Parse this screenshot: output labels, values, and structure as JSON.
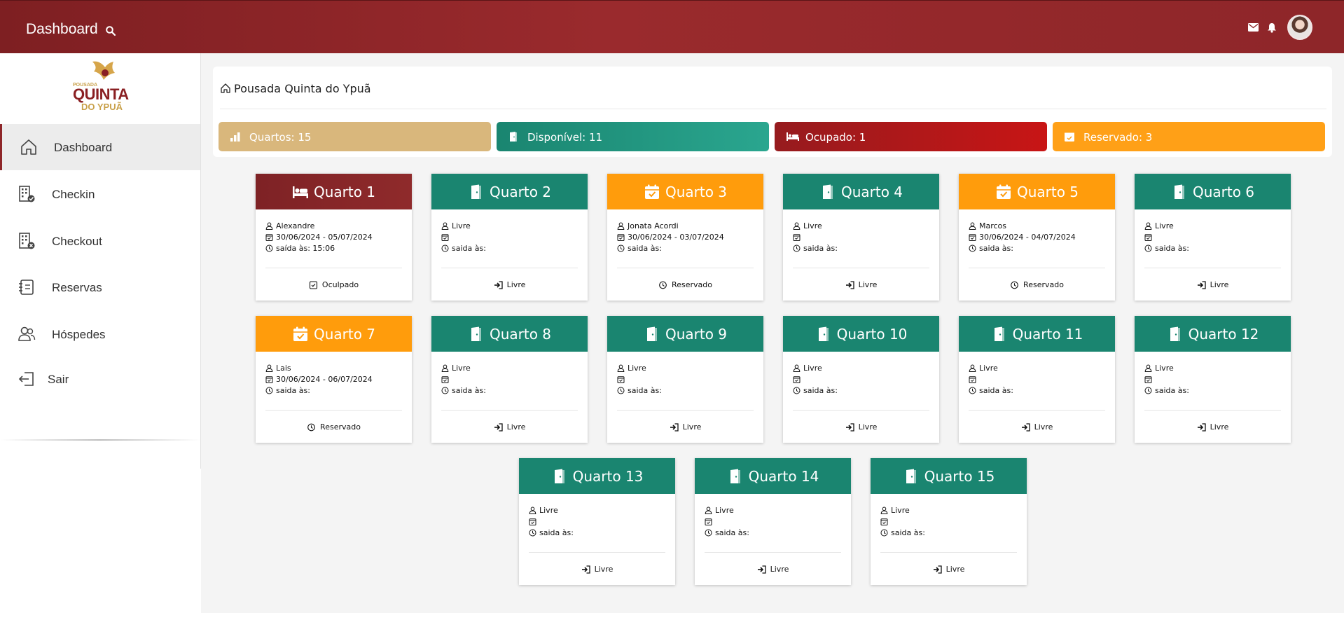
{
  "topbar": {
    "title": "Dashboard",
    "icons": [
      "search-icon",
      "mail-icon",
      "bell-icon"
    ],
    "color": "#8e2629"
  },
  "logo": {
    "small": "POUSADA",
    "big": "QUINTA",
    "sub": "DO YPUÃ"
  },
  "sidebar": {
    "items": [
      {
        "label": "Dashboard",
        "icon": "home-icon",
        "active": true
      },
      {
        "label": "Checkin",
        "icon": "building-check-icon"
      },
      {
        "label": "Checkout",
        "icon": "building-x-icon"
      },
      {
        "label": "Reservas",
        "icon": "reservation-list-icon"
      },
      {
        "label": "Hóspedes",
        "icon": "guests-icon"
      },
      {
        "label": "Sair",
        "icon": "logout-icon"
      }
    ]
  },
  "breadcrumb": {
    "icon": "home-icon",
    "text": "Pousada Quinta do Ypuã"
  },
  "stats": [
    {
      "label": "Quartos: 15",
      "icon": "bar-chart-icon",
      "color": "#d9b77c"
    },
    {
      "label": "Disponível: 11",
      "icon": "door-icon",
      "color": "#1d8f79"
    },
    {
      "label": "Ocupado: 1",
      "icon": "bed-icon",
      "color": "#b21a1a"
    },
    {
      "label": "Reservado: 3",
      "icon": "calendar-check-icon",
      "color": "#ffa017"
    }
  ],
  "colors": {
    "occupied": "#8f2a2b",
    "reserved": "#ff9c0c",
    "free": "#1a8570"
  },
  "rooms": [
    {
      "title": "Quarto 1",
      "state": "occupied",
      "guest": "Alexandre",
      "dates": "30/06/2024 - 05/07/2024",
      "checkout": "saída às: 15:06",
      "status": "Oculpado"
    },
    {
      "title": "Quarto 2",
      "state": "free",
      "guest": "Livre",
      "dates": "",
      "checkout": "saida às:",
      "status": "Livre"
    },
    {
      "title": "Quarto 3",
      "state": "reserved",
      "guest": "Jonata Acordi",
      "dates": "30/06/2024 - 03/07/2024",
      "checkout": "saida às:",
      "status": "Reservado"
    },
    {
      "title": "Quarto 4",
      "state": "free",
      "guest": "Livre",
      "dates": "",
      "checkout": "saida às:",
      "status": "Livre"
    },
    {
      "title": "Quarto 5",
      "state": "reserved",
      "guest": "Marcos",
      "dates": "30/06/2024 - 04/07/2024",
      "checkout": "saida às:",
      "status": "Reservado"
    },
    {
      "title": "Quarto 6",
      "state": "free",
      "guest": "Livre",
      "dates": "",
      "checkout": "saida às:",
      "status": "Livre"
    },
    {
      "title": "Quarto 7",
      "state": "reserved",
      "guest": "Lais",
      "dates": "30/06/2024 - 06/07/2024",
      "checkout": "saida às:",
      "status": "Reservado"
    },
    {
      "title": "Quarto 8",
      "state": "free",
      "guest": "Livre",
      "dates": "",
      "checkout": "saida às:",
      "status": "Livre"
    },
    {
      "title": "Quarto 9",
      "state": "free",
      "guest": "Livre",
      "dates": "",
      "checkout": "saida às:",
      "status": "Livre"
    },
    {
      "title": "Quarto 10",
      "state": "free",
      "guest": "Livre",
      "dates": "",
      "checkout": "saida às:",
      "status": "Livre"
    },
    {
      "title": "Quarto 11",
      "state": "free",
      "guest": "Livre",
      "dates": "",
      "checkout": "saida às:",
      "status": "Livre"
    },
    {
      "title": "Quarto 12",
      "state": "free",
      "guest": "Livre",
      "dates": "",
      "checkout": "saida às:",
      "status": "Livre"
    },
    {
      "title": "Quarto 13",
      "state": "free",
      "guest": "Livre",
      "dates": "",
      "checkout": "saida às:",
      "status": "Livre"
    },
    {
      "title": "Quarto 14",
      "state": "free",
      "guest": "Livre",
      "dates": "",
      "checkout": "saida às:",
      "status": "Livre"
    },
    {
      "title": "Quarto 15",
      "state": "free",
      "guest": "Livre",
      "dates": "",
      "checkout": "saida às:",
      "status": "Livre"
    }
  ]
}
